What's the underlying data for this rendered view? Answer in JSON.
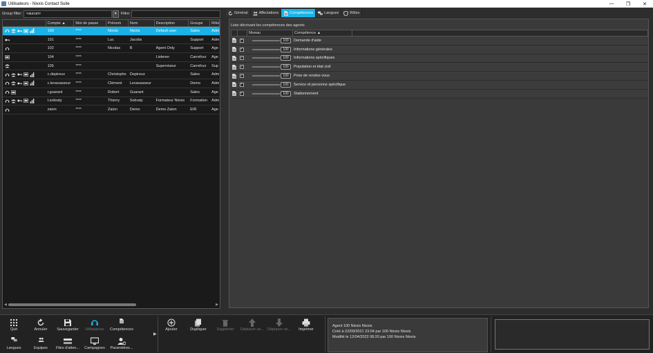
{
  "window": {
    "title": "Utilisateurs - Nixxis Contact Suite"
  },
  "filters": {
    "group_label": "Group filter:",
    "group_value": "<aucun>",
    "filter_label": "Filtre:",
    "filter_value": ""
  },
  "users": {
    "headers": [
      "Compte ▲",
      "Mot de passe",
      "Prénom",
      "Nom",
      "Description",
      "Groupe",
      "Rôle"
    ],
    "rows": [
      {
        "icons": [
          "agent",
          "monitor",
          "key",
          "desk",
          "stats"
        ],
        "compte": "100",
        "mdp": "****",
        "prenom": "Nixxis",
        "nom": "Nixxis",
        "desc": "Default user",
        "groupe": "Sales",
        "role": "Adm",
        "selected": true
      },
      {
        "icons": [
          "key"
        ],
        "compte": "101",
        "mdp": "****",
        "prenom": "Luc",
        "nom": "Jacobs",
        "desc": "",
        "groupe": "Support",
        "role": "Adm",
        "selected": false
      },
      {
        "icons": [
          "agent"
        ],
        "compte": "102",
        "mdp": "****",
        "prenom": "Nicolas",
        "nom": "B",
        "desc": "Agent Only",
        "groupe": "Support",
        "role": "Age",
        "selected": false
      },
      {
        "icons": [
          "desk"
        ],
        "compte": "104",
        "mdp": "****",
        "prenom": "",
        "nom": "",
        "desc": "Listener",
        "groupe": "Carrefour",
        "role": "Age",
        "selected": false
      },
      {
        "icons": [
          "monitor"
        ],
        "compte": "105",
        "mdp": "****",
        "prenom": "",
        "nom": "",
        "desc": "Superviseur",
        "groupe": "Carrefour",
        "role": "Sup",
        "selected": false
      },
      {
        "icons": [
          "agent",
          "monitor",
          "key",
          "desk",
          "stats"
        ],
        "compte": "c.depireux",
        "mdp": "****",
        "prenom": "Christophe",
        "nom": "Depireux",
        "desc": "",
        "groupe": "Sales",
        "role": "Adm",
        "selected": false
      },
      {
        "icons": [
          "agent",
          "monitor",
          "key",
          "desk",
          "stats"
        ],
        "compte": "c.levavasseur",
        "mdp": "****",
        "prenom": "Clément",
        "nom": "Levavasseur",
        "desc": "",
        "groupe": "Demo",
        "role": "Adm",
        "selected": false
      },
      {
        "icons": [
          "agent",
          "desk"
        ],
        "compte": "r.guarant",
        "mdp": "****",
        "prenom": "Robert",
        "nom": "Guarant",
        "desc": "",
        "groupe": "Sales",
        "role": "Age",
        "selected": false
      },
      {
        "icons": [
          "agent",
          "monitor",
          "key",
          "desk",
          "stats"
        ],
        "compte": "t.sobraty",
        "mdp": "****",
        "prenom": "Thierry",
        "nom": "Sobraty",
        "desc": "Formateur Nixxis",
        "groupe": "Formation",
        "role": "Adm",
        "selected": false
      },
      {
        "icons": [
          "agent"
        ],
        "compte": "zaion",
        "mdp": "****",
        "prenom": "Zaion",
        "nom": "Demo",
        "desc": "Demo Zaion",
        "groupe": "EIR",
        "role": "Age",
        "selected": false
      }
    ]
  },
  "tabs": [
    {
      "label": "Général",
      "icon": "refresh-icon",
      "active": false
    },
    {
      "label": "Affectations",
      "icon": "people-icon",
      "active": false
    },
    {
      "label": "Compétences",
      "icon": "document-icon",
      "active": true
    },
    {
      "label": "Langues",
      "icon": "speech-icon",
      "active": false
    },
    {
      "label": "Rôles",
      "icon": "shield-icon",
      "active": false
    }
  ],
  "competences": {
    "caption": "Liste décrivant les compétences des agents",
    "headers": [
      "Niveau",
      "Compétence ▲"
    ],
    "rows": [
      {
        "checked": true,
        "level": "100",
        "name": "Demande d'aide"
      },
      {
        "checked": true,
        "level": "100",
        "name": "Informations générales"
      },
      {
        "checked": true,
        "level": "100",
        "name": "Informations spécifiques"
      },
      {
        "checked": true,
        "level": "100",
        "name": "Population et état civil"
      },
      {
        "checked": true,
        "level": "100",
        "name": "Prise de rendez-vous"
      },
      {
        "checked": true,
        "level": "100",
        "name": "Service et personne spécifique"
      },
      {
        "checked": true,
        "level": "100",
        "name": "Stationnement"
      }
    ]
  },
  "toolbar": {
    "row1": [
      {
        "label": "Quit",
        "icon": "grid-icon",
        "enabled": true
      },
      {
        "label": "Annuler",
        "icon": "undo-icon",
        "enabled": true
      },
      {
        "label": "Sauvegarder",
        "icon": "save-icon",
        "enabled": true
      },
      {
        "label": "Utilisateurs",
        "icon": "agent-icon",
        "enabled": false
      },
      {
        "label": "Compétences",
        "icon": "document-icon",
        "enabled": true
      }
    ],
    "row2": [
      {
        "label": "Langues",
        "icon": "speech-icon",
        "enabled": true
      },
      {
        "label": "Equipes",
        "icon": "people-icon",
        "enabled": true
      },
      {
        "label": "Files d'atten...",
        "icon": "queue-icon",
        "enabled": true
      },
      {
        "label": "Campagnes",
        "icon": "monitor-icon",
        "enabled": true
      },
      {
        "label": "Paramètres...",
        "icon": "user-gear-icon",
        "enabled": true
      }
    ],
    "actions": [
      {
        "label": "Ajouter",
        "icon": "plus-icon",
        "enabled": true
      },
      {
        "label": "Dupliquer",
        "icon": "copy-icon",
        "enabled": true
      },
      {
        "label": "Supprimer",
        "icon": "trash-icon",
        "enabled": false
      },
      {
        "label": "Déplacer ve...",
        "icon": "move-up-icon",
        "enabled": false
      },
      {
        "label": "Déplacer ve...",
        "icon": "move-down-icon",
        "enabled": false
      },
      {
        "label": "Imprimer",
        "icon": "print-icon",
        "enabled": true
      }
    ]
  },
  "info": {
    "line1": "Agent 100 Nixxis Nixxis",
    "line2": "Créé à 22/09/2021 23:04 par 100 Nixxis Nixxis",
    "line3": "Modifié le 12/04/2022 08:20 par 100 Nixxis Nixxis"
  },
  "colors": {
    "accent": "#1ab3e8",
    "background": "#2d2d2d",
    "panel": "#3a3a3a"
  }
}
